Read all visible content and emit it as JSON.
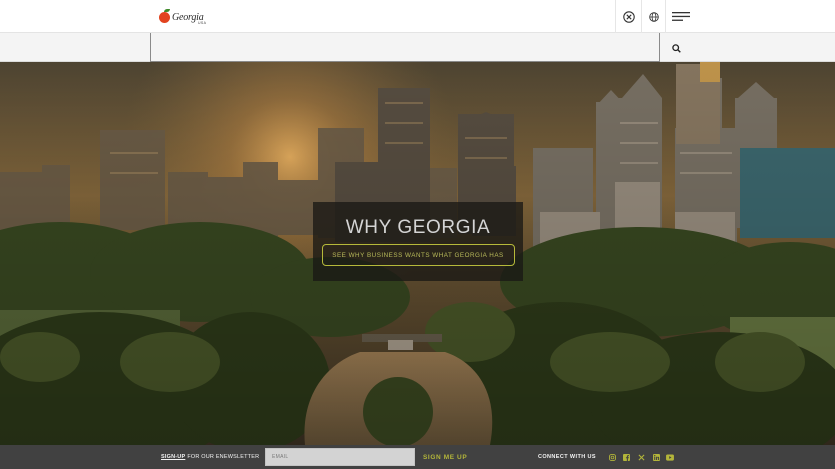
{
  "header": {
    "logo": {
      "wordmark": "Georgia",
      "sub": "USA"
    },
    "icons": {
      "close": "close-circle-icon",
      "language": "globe-icon",
      "menu": "hamburger-menu-icon"
    }
  },
  "search": {
    "value": "",
    "placeholder": "",
    "button_icon": "search-icon"
  },
  "hero": {
    "title": "WHY GEORGIA",
    "cta_label": "SEE WHY BUSINESS WANTS WHAT GEORGIA HAS"
  },
  "newsletter": {
    "signup_link": "SIGN-UP",
    "label_rest": "FOR OUR ENEWSLETTER",
    "email_placeholder": "EMAIL",
    "email_value": "",
    "submit_label": "SIGN ME UP"
  },
  "social": {
    "label": "CONNECT WITH US",
    "icons": [
      "instagram-icon",
      "facebook-icon",
      "x-icon",
      "linkedin-icon",
      "youtube-icon"
    ]
  },
  "colors": {
    "accent": "#b3b53a",
    "footer_bg": "#414141",
    "hero_card_bg": "#1a1814",
    "peach": "#e2431f"
  }
}
